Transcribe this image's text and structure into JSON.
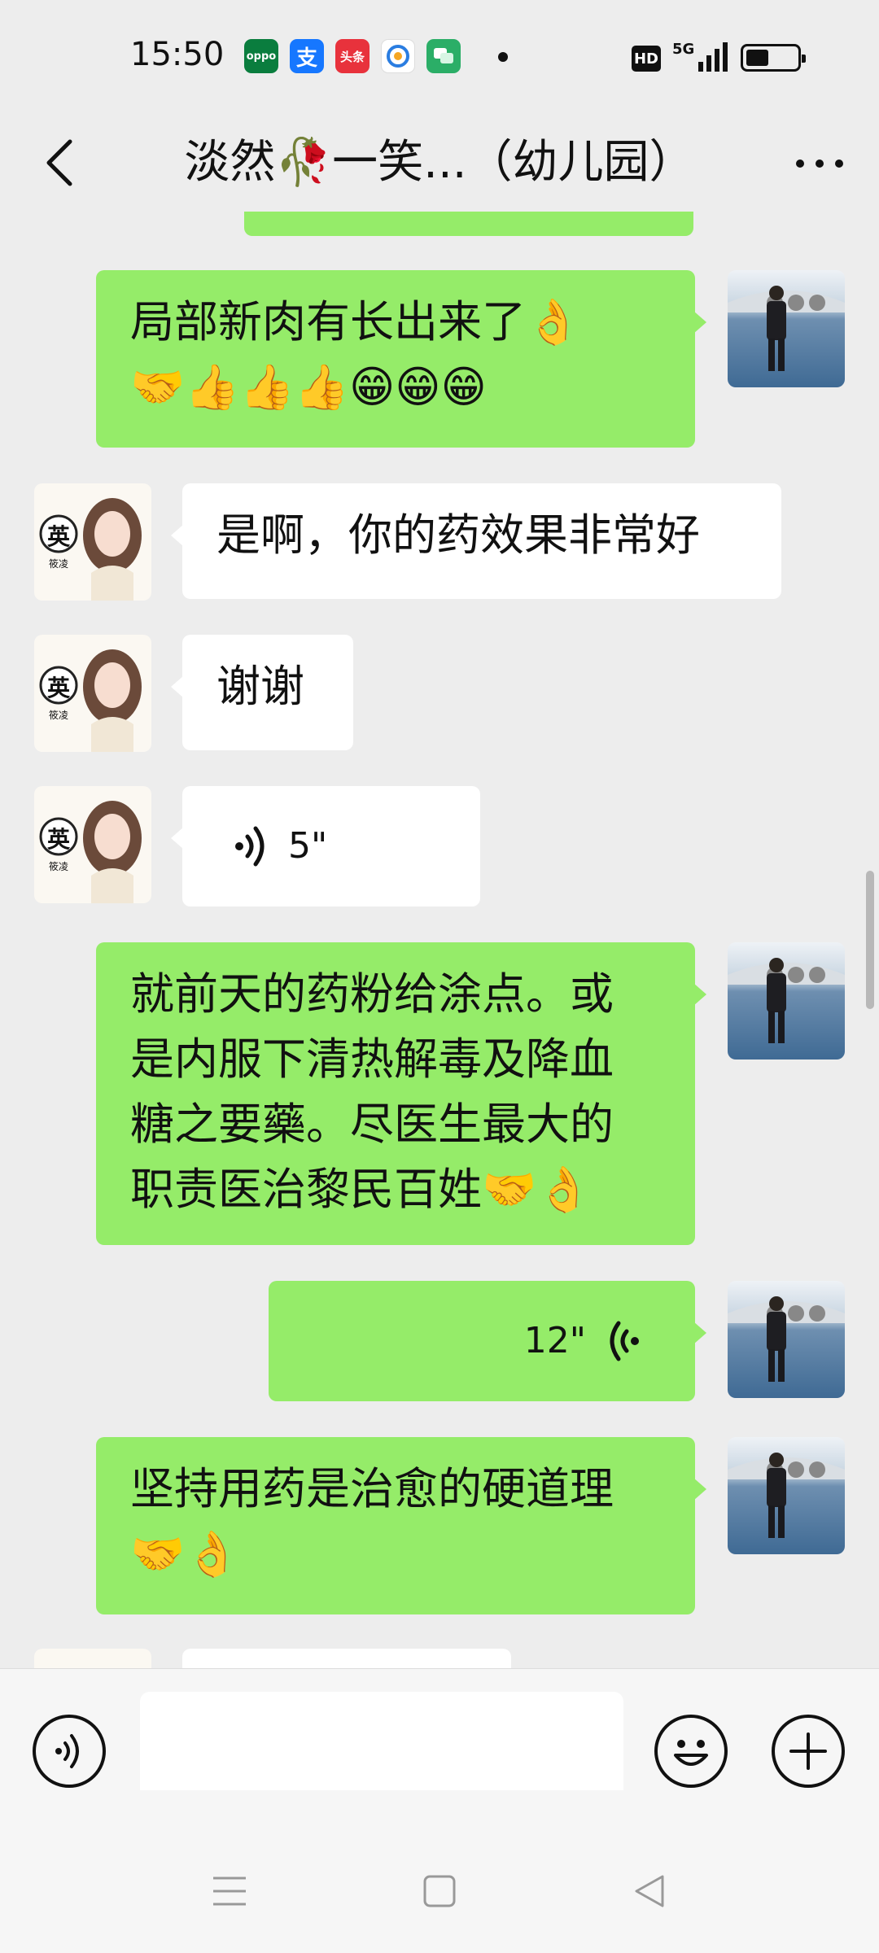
{
  "status_bar": {
    "time": "15:50",
    "apps": [
      {
        "icon": "oppo-app-icon",
        "label": "oppo",
        "color": "#0a7d3e"
      },
      {
        "icon": "alipay-app-icon",
        "label": "支",
        "color": "#1677ff"
      },
      {
        "icon": "toutiao-app-icon",
        "label": "头条",
        "color": "#e8323c"
      },
      {
        "icon": "browser-app-icon",
        "label": "",
        "color": "#ffffff"
      },
      {
        "icon": "wechat-app-icon",
        "label": "",
        "color": "#2bae67"
      }
    ],
    "hd": "HD",
    "network": "5G",
    "battery_level": 0.45
  },
  "header": {
    "title": "淡然🥀一笑...（幼儿园）"
  },
  "messages": [
    {
      "side": "right",
      "type": "text",
      "lines": [
        "局部新肉有长出来了👌",
        "🤝👍👍👍😁😁😁"
      ]
    },
    {
      "side": "left",
      "type": "text",
      "lines": [
        "是啊，你的药效果非常好"
      ]
    },
    {
      "side": "left",
      "type": "text",
      "lines": [
        "谢谢"
      ]
    },
    {
      "side": "left",
      "type": "voice",
      "duration": "5\""
    },
    {
      "side": "right",
      "type": "text",
      "lines": [
        "就前天的药粉给涂点。或",
        "是内服下清热解毒及降血",
        "糖之要藥。尽医生最大的",
        "职责医治黎民百姓🤝👌"
      ]
    },
    {
      "side": "right",
      "type": "voice",
      "duration": "12\""
    },
    {
      "side": "right",
      "type": "text",
      "lines": [
        "坚持用药是治愈的硬道理",
        "🤝👌"
      ]
    }
  ],
  "girl_avatar": {
    "badge": "英",
    "name": "筱凌"
  },
  "colors": {
    "outgoing_bubble": "#95ec69",
    "incoming_bubble": "#ffffff",
    "background": "#ededed"
  }
}
